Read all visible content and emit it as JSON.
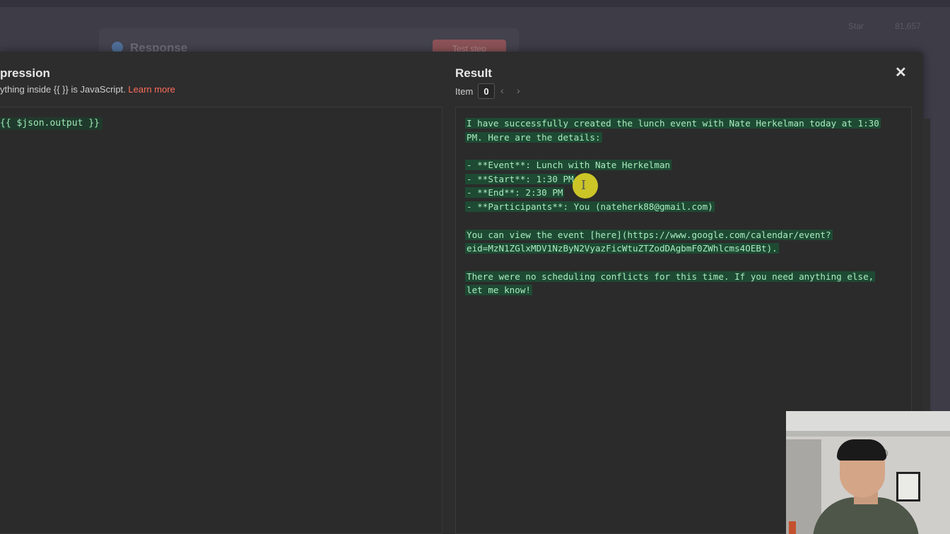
{
  "background": {
    "node_title": "Response",
    "test_step_label": "Test step",
    "star_label": "Star",
    "star_count": "81,657"
  },
  "expression": {
    "title": "pression",
    "hint_prefix": "ything inside {{  }} is JavaScript.",
    "learn_more": "Learn more",
    "code": "{{ $json.output }}"
  },
  "result": {
    "title": "Result",
    "item_label": "Item",
    "item_index": "0",
    "prev_icon": "‹",
    "next_icon": "›",
    "close_icon": "✕",
    "lines": [
      "I have successfully created the lunch event with Nate Herkelman today at 1:30",
      "PM. Here are the details:",
      "",
      "- **Event**: Lunch with Nate Herkelman",
      "- **Start**: 1:30 PM",
      "- **End**: 2:30 PM",
      "- **Participants**: You (nateherk88@gmail.com)",
      "",
      "You can view the event [here](https://www.google.com/calendar/event?",
      "eid=MzN1ZGlxMDV1NzByN2VyazFicWtuZTZodDAgbmF0ZWhlcms4OEBt).",
      "",
      "There were no scheduling conflicts for this time. If you need anything else,",
      "let me know!"
    ]
  },
  "colors": {
    "accent_link": "#ff6d5a",
    "code_text": "#a8ecbf",
    "code_highlight": "#1e4a33"
  }
}
